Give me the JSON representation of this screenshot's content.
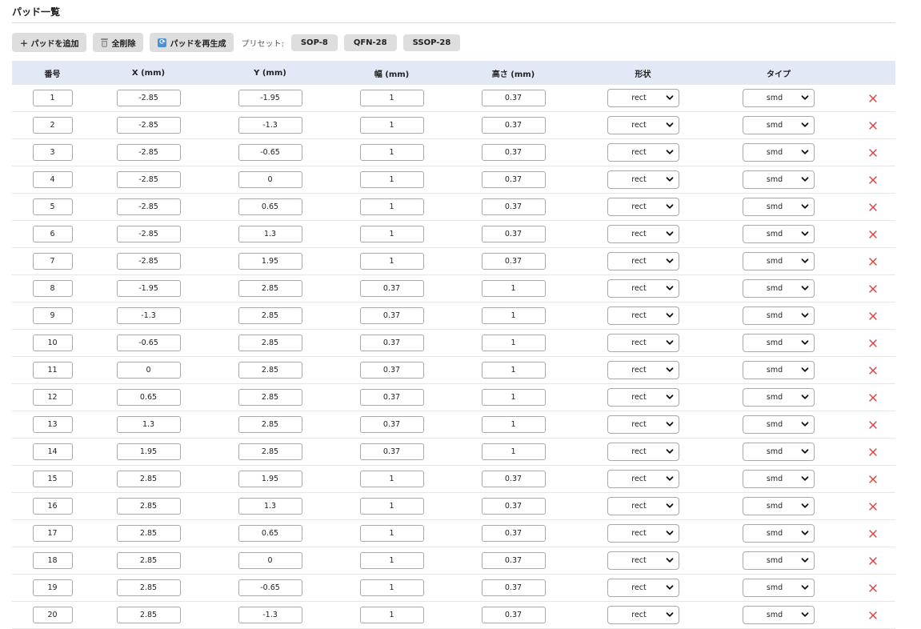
{
  "section": {
    "title": "パッド一覧"
  },
  "toolbar": {
    "add_label": "＋ パッドを追加",
    "clear_label": "全削除",
    "regen_label": "パッドを再生成",
    "preset_label": "プリセット:",
    "presets": [
      "SOP-8",
      "QFN-28",
      "SSOP-28"
    ]
  },
  "table": {
    "headers": [
      "番号",
      "X (mm)",
      "Y (mm)",
      "幅 (mm)",
      "高さ (mm)",
      "形状",
      "タイプ",
      ""
    ],
    "rows": [
      {
        "num": "1",
        "x": "-2.85",
        "y": "-1.95",
        "w": "1",
        "h": "0.37",
        "shape": "rect",
        "type": "smd"
      },
      {
        "num": "2",
        "x": "-2.85",
        "y": "-1.3",
        "w": "1",
        "h": "0.37",
        "shape": "rect",
        "type": "smd"
      },
      {
        "num": "3",
        "x": "-2.85",
        "y": "-0.65",
        "w": "1",
        "h": "0.37",
        "shape": "rect",
        "type": "smd"
      },
      {
        "num": "4",
        "x": "-2.85",
        "y": "0",
        "w": "1",
        "h": "0.37",
        "shape": "rect",
        "type": "smd"
      },
      {
        "num": "5",
        "x": "-2.85",
        "y": "0.65",
        "w": "1",
        "h": "0.37",
        "shape": "rect",
        "type": "smd"
      },
      {
        "num": "6",
        "x": "-2.85",
        "y": "1.3",
        "w": "1",
        "h": "0.37",
        "shape": "rect",
        "type": "smd"
      },
      {
        "num": "7",
        "x": "-2.85",
        "y": "1.95",
        "w": "1",
        "h": "0.37",
        "shape": "rect",
        "type": "smd"
      },
      {
        "num": "8",
        "x": "-1.95",
        "y": "2.85",
        "w": "0.37",
        "h": "1",
        "shape": "rect",
        "type": "smd"
      },
      {
        "num": "9",
        "x": "-1.3",
        "y": "2.85",
        "w": "0.37",
        "h": "1",
        "shape": "rect",
        "type": "smd"
      },
      {
        "num": "10",
        "x": "-0.65",
        "y": "2.85",
        "w": "0.37",
        "h": "1",
        "shape": "rect",
        "type": "smd"
      },
      {
        "num": "11",
        "x": "0",
        "y": "2.85",
        "w": "0.37",
        "h": "1",
        "shape": "rect",
        "type": "smd"
      },
      {
        "num": "12",
        "x": "0.65",
        "y": "2.85",
        "w": "0.37",
        "h": "1",
        "shape": "rect",
        "type": "smd"
      },
      {
        "num": "13",
        "x": "1.3",
        "y": "2.85",
        "w": "0.37",
        "h": "1",
        "shape": "rect",
        "type": "smd"
      },
      {
        "num": "14",
        "x": "1.95",
        "y": "2.85",
        "w": "0.37",
        "h": "1",
        "shape": "rect",
        "type": "smd"
      },
      {
        "num": "15",
        "x": "2.85",
        "y": "1.95",
        "w": "1",
        "h": "0.37",
        "shape": "rect",
        "type": "smd"
      },
      {
        "num": "16",
        "x": "2.85",
        "y": "1.3",
        "w": "1",
        "h": "0.37",
        "shape": "rect",
        "type": "smd"
      },
      {
        "num": "17",
        "x": "2.85",
        "y": "0.65",
        "w": "1",
        "h": "0.37",
        "shape": "rect",
        "type": "smd"
      },
      {
        "num": "18",
        "x": "2.85",
        "y": "0",
        "w": "1",
        "h": "0.37",
        "shape": "rect",
        "type": "smd"
      },
      {
        "num": "19",
        "x": "2.85",
        "y": "-0.65",
        "w": "1",
        "h": "0.37",
        "shape": "rect",
        "type": "smd"
      },
      {
        "num": "20",
        "x": "2.85",
        "y": "-1.3",
        "w": "1",
        "h": "0.37",
        "shape": "rect",
        "type": "smd"
      }
    ]
  },
  "icons": {
    "delete": "close-x-icon",
    "select": "chevron-down-icon",
    "trash": "trash-icon",
    "regen": "refresh-icon"
  },
  "colors": {
    "header_bg": "#e3e8f6",
    "delete": "#e03c3c",
    "button_bg": "#dedede"
  }
}
